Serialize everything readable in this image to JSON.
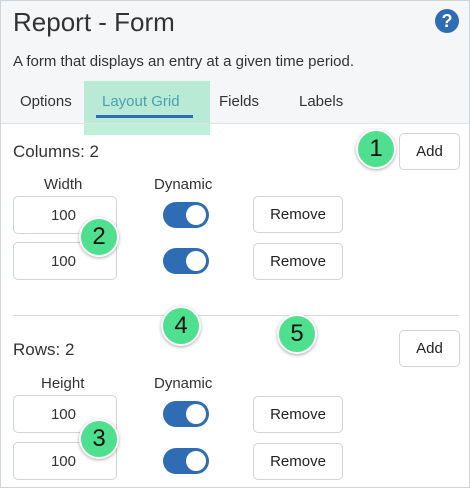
{
  "header": {
    "title": "Report - Form",
    "description": "A form that displays an entry at a given time period.",
    "help_icon": "?"
  },
  "tabs": [
    {
      "label": "Options",
      "active": false
    },
    {
      "label": "Layout Grid",
      "active": true
    },
    {
      "label": "Fields",
      "active": false
    },
    {
      "label": "Labels",
      "active": false
    }
  ],
  "columns": {
    "label": "Columns: 2",
    "add_label": "Add",
    "head_size": "Width",
    "head_dynamic": "Dynamic",
    "rows": [
      {
        "value": "100",
        "dynamic": true,
        "remove_label": "Remove"
      },
      {
        "value": "100",
        "dynamic": true,
        "remove_label": "Remove"
      }
    ]
  },
  "rows": {
    "label": "Rows: 2",
    "add_label": "Add",
    "head_size": "Height",
    "head_dynamic": "Dynamic",
    "rows": [
      {
        "value": "100",
        "dynamic": true,
        "remove_label": "Remove"
      },
      {
        "value": "100",
        "dynamic": true,
        "remove_label": "Remove"
      }
    ]
  },
  "markers": [
    "1",
    "2",
    "3",
    "4",
    "5"
  ],
  "colors": {
    "accent": "#2e6db4",
    "marker": "#4ee08f",
    "highlight": "#6edcaa"
  }
}
